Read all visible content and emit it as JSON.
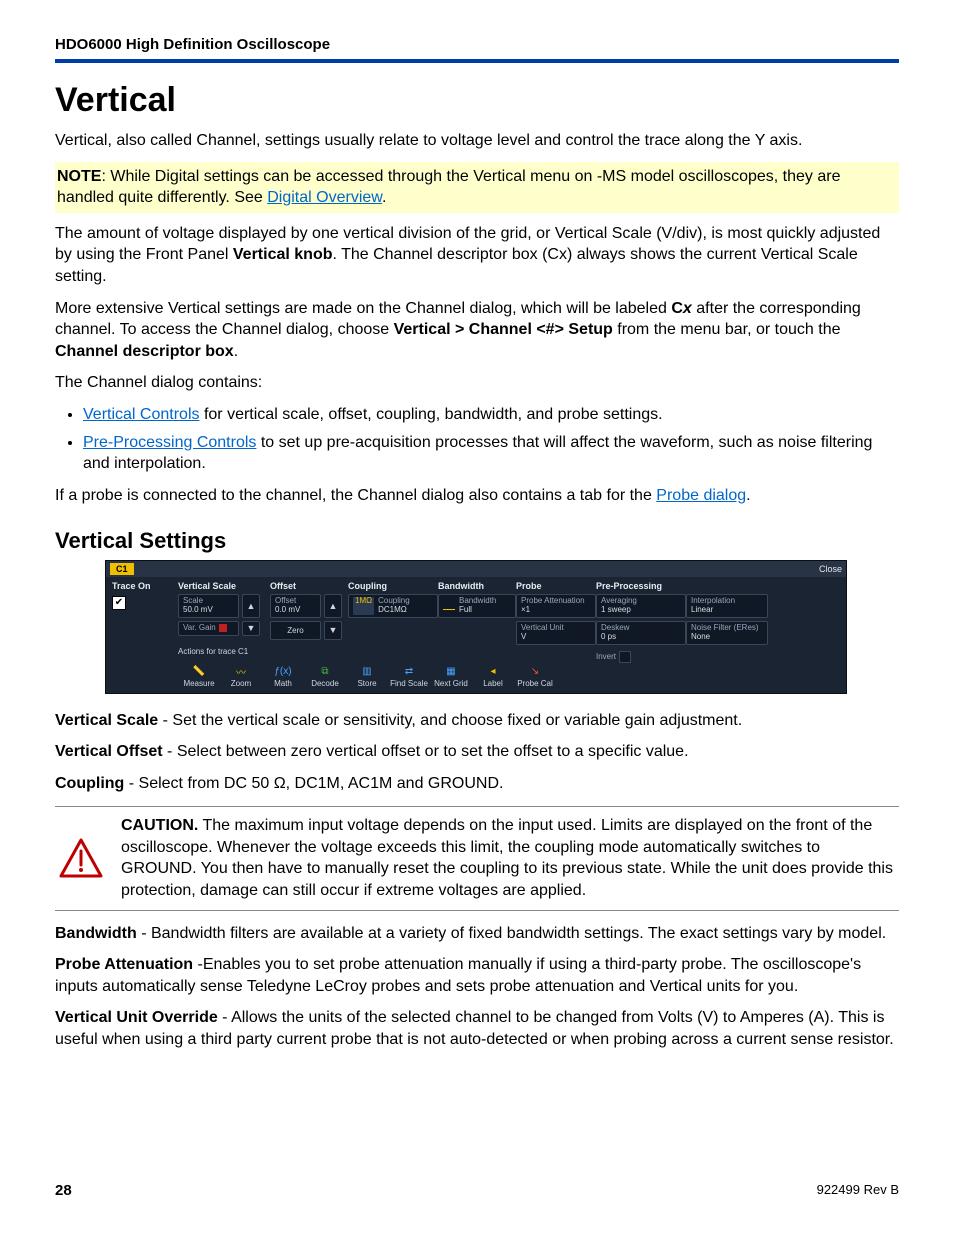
{
  "header": "HDO6000 High Definition Oscilloscope",
  "h1": "Vertical",
  "intro": "Vertical, also called Channel, settings usually relate to voltage level and control the trace along the Y axis.",
  "note": {
    "bold": "NOTE",
    "body1": ": While Digital settings can be accessed through the Vertical menu on -MS model oscilloscopes, they are handled quite differently. See ",
    "link": "Digital Overview",
    "body2": "."
  },
  "para2a": "The amount of voltage displayed by one vertical division of the grid, or Vertical Scale (V/div), is most quickly adjusted by using the Front Panel ",
  "para2bold": "Vertical knob",
  "para2b": ". The Channel descriptor box (Cx) always shows the current Vertical Scale setting.",
  "para3a": "More extensive Vertical settings are made on the Channel dialog, which will be labeled ",
  "para3bold1": "C",
  "para3italic": "x",
  "para3b": " after the corresponding channel. To access the Channel dialog, choose ",
  "para3bold2": "Vertical > Channel <#> Setup",
  "para3c": " from the menu bar, or touch the ",
  "para3bold3": "Channel descriptor box",
  "para3d": ".",
  "para4": "The Channel dialog contains:",
  "bullets": [
    {
      "link": "Vertical Controls",
      "rest": " for vertical scale, offset, coupling, bandwidth, and probe settings."
    },
    {
      "link": "Pre-Processing Controls",
      "rest": " to set up pre-acquisition processes that will affect the waveform, such as noise filtering and interpolation."
    }
  ],
  "para5a": "If a probe is connected to the channel, the Channel dialog also contains a tab for the ",
  "para5link": "Probe dialog",
  "para5b": ".",
  "h2": "Vertical Settings",
  "scr": {
    "tab": "C1",
    "close": "Close",
    "traceOn": "Trace On",
    "check": "✔",
    "vscale": {
      "title": "Vertical Scale",
      "scaleLabel": "Scale",
      "scaleVal": "50.0 mV",
      "vgLabel": "Var. Gain",
      "actionsTitle": "Actions for trace C1"
    },
    "offset": {
      "title": "Offset",
      "offLabel": "Offset",
      "offVal": "0.0 mV",
      "zero": "Zero"
    },
    "coupling": {
      "title": "Coupling",
      "imp": "1MΩ",
      "cLabel": "Coupling",
      "cVal": "DC1MΩ"
    },
    "bandwidth": {
      "title": "Bandwidth",
      "bLabel": "Bandwidth",
      "bVal": "Full"
    },
    "probe": {
      "title": "Probe",
      "attLabel": "Probe Attenuation",
      "attVal": "×1",
      "vuLabel": "Vertical Unit",
      "vuVal": "V"
    },
    "pp": {
      "title": "Pre-Processing",
      "avgLabel": "Averaging",
      "avgVal": "1 sweep",
      "dskLabel": "Deskew",
      "dskVal": "0 ps",
      "invert": "Invert"
    },
    "pp2": {
      "intLabel": "Interpolation",
      "intVal": "Linear",
      "nfLabel": "Noise Filter (ERes)",
      "nfVal": "None"
    },
    "actions": [
      "Measure",
      "Zoom",
      "Math",
      "Decode",
      "Store",
      "Find Scale",
      "Next Grid",
      "Label",
      "Probe Cal"
    ]
  },
  "defs": {
    "vscale": {
      "term": "Vertical Scale",
      "body": " - Set the vertical scale or sensitivity, and choose fixed or variable gain adjustment."
    },
    "voffset": {
      "term": "Vertical Offset",
      "body": " - Select between zero vertical offset or to set the offset to a specific value."
    },
    "coupling": {
      "term": "Coupling",
      "body": " - Select from DC 50 Ω, DC1M, AC1M and GROUND."
    }
  },
  "caution": {
    "term": "CAUTION.",
    "body": " The maximum input voltage depends on the input used. Limits are displayed on the front of the oscilloscope. Whenever the voltage exceeds this limit, the coupling mode automatically switches to GROUND. You then have to manually reset the coupling to its previous state. While the unit does provide this protection, damage can still occur if extreme voltages are applied."
  },
  "defs2": {
    "bw": {
      "term": "Bandwidth",
      "body": " - Bandwidth filters are available at a variety of fixed bandwidth settings. The exact settings vary by model."
    },
    "probe": {
      "term": "Probe Attenuation",
      "body": " -Enables you to set probe attenuation manually if using a third-party probe. The oscilloscope's inputs automatically sense Teledyne LeCroy probes and sets probe attenuation and Vertical units for you."
    },
    "vuo": {
      "term": "Vertical Unit Override",
      "body": " - Allows the units of the selected channel to be changed from Volts (V) to Amperes (A). This is useful when using a third party current probe that is not auto-detected or when probing across a current sense resistor."
    }
  },
  "footer": {
    "page": "28",
    "rev": "922499 Rev B"
  }
}
